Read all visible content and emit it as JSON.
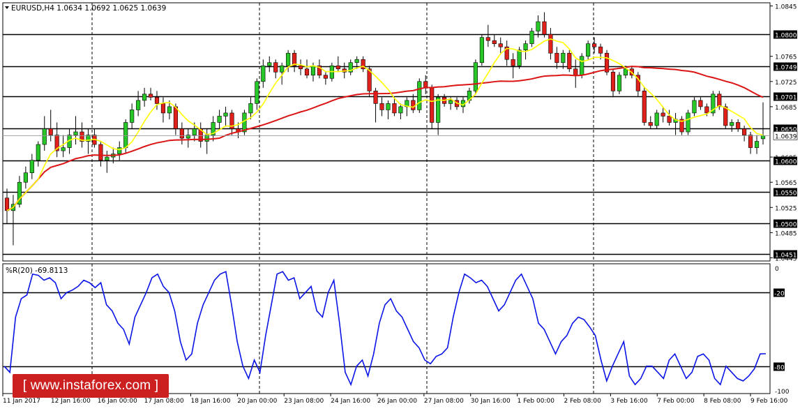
{
  "header": {
    "symbol_line": "EURUSD,H4  1.0634 1.0692 1.0625 1.0639",
    "indicator_line": "%R(20) -69.8113"
  },
  "watermark": {
    "text": "[ www.instaforex.com ]"
  },
  "colors": {
    "bull": "#28c728",
    "bear": "#e0201b",
    "doji": "#000000",
    "ma_fast": "#ffff00",
    "ma_slow": "#dc1414",
    "wpr": "#0a14e6",
    "level": "#000000",
    "grid": "#000000"
  },
  "chart_data": [
    {
      "type": "candlestick",
      "symbol": "EURUSD",
      "timeframe": "H4",
      "last_bar": {
        "open": 1.0634,
        "high": 1.0692,
        "low": 1.0625,
        "close": 1.0639
      },
      "ylim": [
        1.044,
        1.085
      ],
      "y_ticks": [
        "1.0845",
        "1.0765",
        "1.0725",
        "1.0685",
        "1.0605",
        "1.0565",
        "1.0525",
        "1.0485",
        "1.0445"
      ],
      "x_ticks": [
        "11 Jan 2017",
        "12 Jan 16:00",
        "16 Jan 00:00",
        "17 Jan 08:00",
        "18 Jan 16:00",
        "20 Jan 00:00",
        "23 Jan 08:00",
        "24 Jan 16:00",
        "26 Jan 00:00",
        "27 Jan 08:00",
        "30 Jan 16:00",
        "1 Feb 00:00",
        "2 Feb 08:00",
        "3 Feb 16:00",
        "7 Feb 00:00",
        "8 Feb 08:00",
        "9 Feb 16:00"
      ],
      "levels": [
        {
          "value": 1.08,
          "label": "1.0800"
        },
        {
          "value": 1.0749,
          "label": "1.0749"
        },
        {
          "value": 1.0701,
          "label": "1.0701"
        },
        {
          "value": 1.065,
          "label": "1.0650"
        },
        {
          "value": 1.06,
          "label": "1.0600"
        },
        {
          "value": 1.055,
          "label": "1.0550"
        },
        {
          "value": 1.05,
          "label": "1.0500"
        },
        {
          "value": 1.0451,
          "label": "1.0451"
        }
      ],
      "current_price": {
        "value": 1.0639,
        "label": "1.0639"
      },
      "candles": [
        [
          1.054,
          1.0555,
          1.05,
          1.052
        ],
        [
          1.052,
          1.0545,
          1.0465,
          1.053
        ],
        [
          1.053,
          1.0575,
          1.0525,
          1.0565
        ],
        [
          1.0565,
          1.059,
          1.0555,
          1.058
        ],
        [
          1.058,
          1.061,
          1.057,
          1.06
        ],
        [
          1.06,
          1.063,
          1.059,
          1.0625
        ],
        [
          1.0625,
          1.067,
          1.0615,
          1.065
        ],
        [
          1.065,
          1.068,
          1.063,
          1.064
        ],
        [
          1.064,
          1.066,
          1.0605,
          1.0615
        ],
        [
          1.0615,
          1.064,
          1.0605,
          1.062
        ],
        [
          1.062,
          1.065,
          1.061,
          1.064
        ],
        [
          1.064,
          1.067,
          1.0625,
          1.0645
        ],
        [
          1.0645,
          1.066,
          1.062,
          1.063
        ],
        [
          1.063,
          1.065,
          1.061,
          1.064
        ],
        [
          1.064,
          1.065,
          1.062,
          1.0625
        ],
        [
          1.0625,
          1.063,
          1.059,
          1.06
        ],
        [
          1.06,
          1.0615,
          1.058,
          1.0605
        ],
        [
          1.0605,
          1.062,
          1.0595,
          1.061
        ],
        [
          1.061,
          1.063,
          1.06,
          1.062
        ],
        [
          1.062,
          1.0665,
          1.061,
          1.066
        ],
        [
          1.066,
          1.069,
          1.065,
          1.068
        ],
        [
          1.068,
          1.071,
          1.067,
          1.0695
        ],
        [
          1.0695,
          1.0715,
          1.0685,
          1.0705
        ],
        [
          1.0705,
          1.0715,
          1.0695,
          1.07
        ],
        [
          1.07,
          1.071,
          1.068,
          1.069
        ],
        [
          1.069,
          1.07,
          1.066,
          1.0675
        ],
        [
          1.0675,
          1.0695,
          1.0665,
          1.0685
        ],
        [
          1.0685,
          1.069,
          1.064,
          1.065
        ],
        [
          1.065,
          1.066,
          1.0625,
          1.0635
        ],
        [
          1.0635,
          1.065,
          1.062,
          1.064
        ],
        [
          1.064,
          1.066,
          1.063,
          1.065
        ],
        [
          1.065,
          1.066,
          1.062,
          1.063
        ],
        [
          1.063,
          1.065,
          1.061,
          1.064
        ],
        [
          1.064,
          1.067,
          1.063,
          1.066
        ],
        [
          1.066,
          1.068,
          1.065,
          1.067
        ],
        [
          1.067,
          1.0685,
          1.0655,
          1.0675
        ],
        [
          1.0675,
          1.068,
          1.064,
          1.065
        ],
        [
          1.065,
          1.066,
          1.0635,
          1.0645
        ],
        [
          1.0645,
          1.068,
          1.064,
          1.0675
        ],
        [
          1.0675,
          1.07,
          1.0665,
          1.069
        ],
        [
          1.069,
          1.073,
          1.068,
          1.0725
        ],
        [
          1.0725,
          1.076,
          1.0715,
          1.075
        ],
        [
          1.075,
          1.0765,
          1.074,
          1.0755
        ],
        [
          1.0755,
          1.076,
          1.073,
          1.074
        ],
        [
          1.074,
          1.0755,
          1.072,
          1.075
        ],
        [
          1.075,
          1.0775,
          1.074,
          1.077
        ],
        [
          1.077,
          1.0775,
          1.074,
          1.075
        ],
        [
          1.075,
          1.076,
          1.0735,
          1.0745
        ],
        [
          1.0745,
          1.076,
          1.073,
          1.0735
        ],
        [
          1.0735,
          1.0755,
          1.0725,
          1.075
        ],
        [
          1.075,
          1.076,
          1.073,
          1.0735
        ],
        [
          1.0735,
          1.074,
          1.072,
          1.073
        ],
        [
          1.073,
          1.0755,
          1.0725,
          1.075
        ],
        [
          1.075,
          1.0765,
          1.074,
          1.0745
        ],
        [
          1.0745,
          1.0755,
          1.073,
          1.074
        ],
        [
          1.074,
          1.076,
          1.0735,
          1.0755
        ],
        [
          1.0755,
          1.0765,
          1.0745,
          1.076
        ],
        [
          1.076,
          1.0765,
          1.074,
          1.0745
        ],
        [
          1.0745,
          1.075,
          1.07,
          1.071
        ],
        [
          1.071,
          1.0715,
          1.066,
          1.069
        ],
        [
          1.069,
          1.07,
          1.067,
          1.068
        ],
        [
          1.068,
          1.0695,
          1.0665,
          1.069
        ],
        [
          1.069,
          1.07,
          1.067,
          1.0675
        ],
        [
          1.0675,
          1.069,
          1.0665,
          1.0685
        ],
        [
          1.0685,
          1.07,
          1.067,
          1.0695
        ],
        [
          1.0695,
          1.0705,
          1.0675,
          1.068
        ],
        [
          1.068,
          1.073,
          1.0675,
          1.0725
        ],
        [
          1.0725,
          1.0735,
          1.0705,
          1.0715
        ],
        [
          1.0715,
          1.072,
          1.065,
          1.066
        ],
        [
          1.066,
          1.0705,
          1.064,
          1.07
        ],
        [
          1.07,
          1.0705,
          1.0685,
          1.069
        ],
        [
          1.069,
          1.07,
          1.068,
          1.0695
        ],
        [
          1.0695,
          1.07,
          1.068,
          1.0685
        ],
        [
          1.0685,
          1.07,
          1.0675,
          1.0695
        ],
        [
          1.0695,
          1.0715,
          1.069,
          1.071
        ],
        [
          1.071,
          1.076,
          1.0705,
          1.0755
        ],
        [
          1.0755,
          1.08,
          1.075,
          1.0795
        ],
        [
          1.0795,
          1.0815,
          1.078,
          1.079
        ],
        [
          1.079,
          1.08,
          1.078,
          1.0785
        ],
        [
          1.0785,
          1.0795,
          1.077,
          1.078
        ],
        [
          1.078,
          1.079,
          1.075,
          1.076
        ],
        [
          1.076,
          1.077,
          1.073,
          1.075
        ],
        [
          1.075,
          1.078,
          1.0745,
          1.0775
        ],
        [
          1.0775,
          1.079,
          1.076,
          1.0785
        ],
        [
          1.0785,
          1.081,
          1.078,
          1.0805
        ],
        [
          1.0805,
          1.083,
          1.0795,
          1.082
        ],
        [
          1.082,
          1.0835,
          1.0795,
          1.08
        ],
        [
          1.08,
          1.081,
          1.076,
          1.077
        ],
        [
          1.077,
          1.078,
          1.0745,
          1.0755
        ],
        [
          1.0755,
          1.0775,
          1.0745,
          1.077
        ],
        [
          1.077,
          1.0775,
          1.074,
          1.0745
        ],
        [
          1.0745,
          1.076,
          1.0715,
          1.0735
        ],
        [
          1.0735,
          1.077,
          1.073,
          1.0765
        ],
        [
          1.0765,
          1.079,
          1.076,
          1.0785
        ],
        [
          1.0785,
          1.0795,
          1.077,
          1.078
        ],
        [
          1.078,
          1.0785,
          1.076,
          1.077
        ],
        [
          1.077,
          1.0775,
          1.0735,
          1.074
        ],
        [
          1.074,
          1.0745,
          1.07,
          1.071
        ],
        [
          1.071,
          1.074,
          1.0705,
          1.0735
        ],
        [
          1.0735,
          1.075,
          1.073,
          1.0745
        ],
        [
          1.0745,
          1.075,
          1.073,
          1.0735
        ],
        [
          1.0735,
          1.074,
          1.07,
          1.071
        ],
        [
          1.071,
          1.0715,
          1.0655,
          1.066
        ],
        [
          1.066,
          1.067,
          1.065,
          1.0655
        ],
        [
          1.0655,
          1.068,
          1.065,
          1.0675
        ],
        [
          1.0675,
          1.0685,
          1.066,
          1.067
        ],
        [
          1.067,
          1.068,
          1.0655,
          1.066
        ],
        [
          1.066,
          1.0675,
          1.064,
          1.0665
        ],
        [
          1.0665,
          1.067,
          1.064,
          1.0645
        ],
        [
          1.0645,
          1.068,
          1.064,
          1.0675
        ],
        [
          1.0675,
          1.07,
          1.067,
          1.0695
        ],
        [
          1.0695,
          1.07,
          1.068,
          1.0685
        ],
        [
          1.0685,
          1.069,
          1.067,
          1.0675
        ],
        [
          1.0675,
          1.071,
          1.067,
          1.0705
        ],
        [
          1.0705,
          1.071,
          1.068,
          1.0685
        ],
        [
          1.0685,
          1.069,
          1.065,
          1.0655
        ],
        [
          1.0655,
          1.0665,
          1.0645,
          1.066
        ],
        [
          1.066,
          1.0665,
          1.0645,
          1.065
        ],
        [
          1.065,
          1.0655,
          1.063,
          1.064
        ],
        [
          1.064,
          1.0645,
          1.061,
          1.062
        ],
        [
          1.062,
          1.064,
          1.061,
          1.063
        ],
        [
          1.0634,
          1.0692,
          1.0625,
          1.0639
        ]
      ],
      "ma_fast": {
        "period_hint": "short"
      },
      "ma_slow": {
        "period_hint": "long"
      }
    },
    {
      "type": "line",
      "indicator": "Williams %R",
      "period": 20,
      "last_value": -69.8113,
      "ylim": [
        -100,
        0
      ],
      "levels": [
        {
          "value": -20,
          "label": "-20"
        },
        {
          "value": -80,
          "label": "-80"
        }
      ],
      "y_ticks": [
        {
          "value": 0,
          "label": "0"
        },
        {
          "value": -100,
          "label": "-100"
        }
      ],
      "values": [
        -80,
        -85,
        -40,
        -25,
        -22,
        -5,
        -6,
        -10,
        -8,
        -12,
        -25,
        -20,
        -18,
        -15,
        -10,
        -12,
        -16,
        -12,
        -30,
        -35,
        -45,
        -50,
        -62,
        -40,
        -30,
        -20,
        -8,
        -5,
        -15,
        -20,
        -35,
        -60,
        -75,
        -70,
        -45,
        -30,
        -20,
        -10,
        -5,
        -3,
        -30,
        -60,
        -80,
        -90,
        -75,
        -85,
        -55,
        -30,
        -5,
        -3,
        -10,
        -8,
        -25,
        -20,
        -15,
        -35,
        -40,
        -20,
        -10,
        -45,
        -85,
        -95,
        -80,
        -75,
        -88,
        -70,
        -45,
        -30,
        -25,
        -35,
        -40,
        -50,
        -60,
        -65,
        -75,
        -78,
        -72,
        -70,
        -65,
        -40,
        -20,
        -5,
        -8,
        -12,
        -10,
        -15,
        -25,
        -35,
        -30,
        -20,
        -10,
        -5,
        -15,
        -25,
        -45,
        -50,
        -60,
        -70,
        -60,
        -55,
        -45,
        -40,
        -42,
        -48,
        -55,
        -75,
        -92,
        -80,
        -70,
        -60,
        -88,
        -95,
        -90,
        -80,
        -80,
        -85,
        -90,
        -75,
        -70,
        -80,
        -90,
        -85,
        -72,
        -70,
        -75,
        -90,
        -95,
        -80,
        -85,
        -90,
        -92,
        -88,
        -82,
        -70,
        -69.8113
      ]
    }
  ]
}
